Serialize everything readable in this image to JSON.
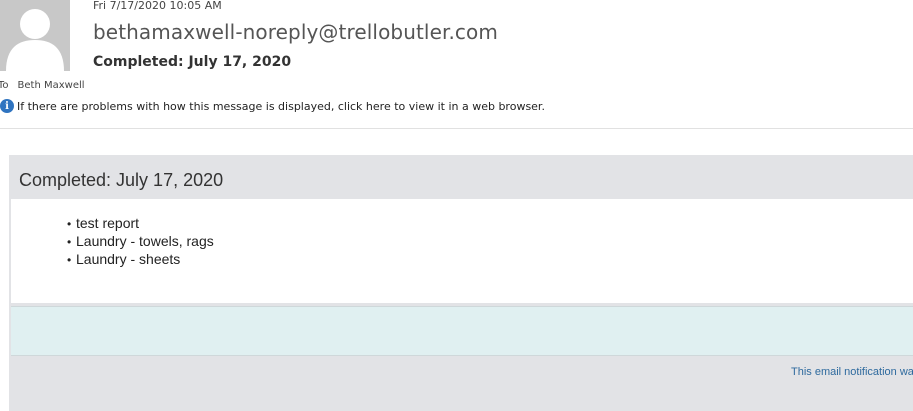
{
  "header": {
    "date": "Fri 7/17/2020 10:05 AM",
    "sender": "bethamaxwell-noreply@trellobutler.com",
    "subject": "Completed: July 17, 2020",
    "to_label": "To",
    "to_name": "Beth Maxwell",
    "info_icon": "info-icon",
    "info_text": "If there are problems with how this message is displayed, click here to view it in a web browser."
  },
  "email": {
    "title": "Completed: July 17, 2020",
    "items": [
      "test report",
      "Laundry - towels, rags",
      "Laundry - sheets"
    ],
    "footer_text": "This email notification was"
  },
  "colors": {
    "avatar_bg": "#c8c8c8",
    "info_icon": "#2f74c0",
    "card_bg": "#e2e3e6",
    "band_bg": "#e0f0f1",
    "footer_link": "#2e6a9e"
  }
}
